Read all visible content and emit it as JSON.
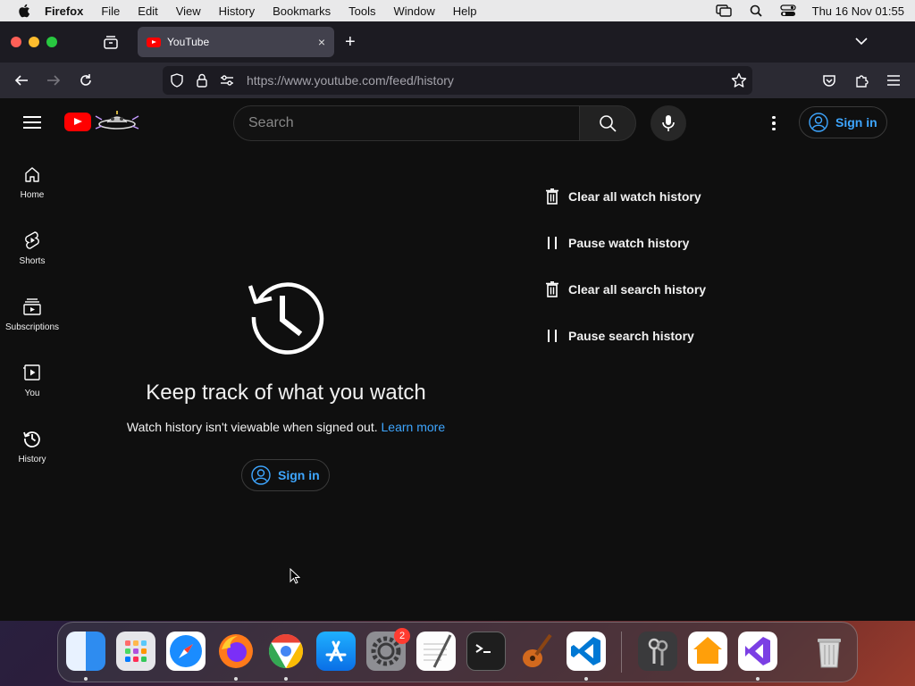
{
  "menubar": {
    "app_name": "Firefox",
    "items": [
      "File",
      "Edit",
      "View",
      "History",
      "Bookmarks",
      "Tools",
      "Window",
      "Help"
    ],
    "clock": "Thu 16 Nov  01:55"
  },
  "browser": {
    "tab_title": "YouTube",
    "tab_close": "×",
    "new_tab": "+",
    "url": "https://www.youtube.com/feed/history"
  },
  "youtube": {
    "search_placeholder": "Search",
    "signin_label": "Sign in",
    "guide": [
      {
        "label": "Home",
        "icon": "home-icon"
      },
      {
        "label": "Shorts",
        "icon": "shorts-icon"
      },
      {
        "label": "Subscriptions",
        "icon": "subscriptions-icon"
      },
      {
        "label": "You",
        "icon": "you-icon"
      },
      {
        "label": "History",
        "icon": "history-icon"
      }
    ],
    "empty_title": "Keep track of what you watch",
    "empty_subtitle": "Watch history isn't viewable when signed out.",
    "learn_more": "Learn more",
    "actions": [
      {
        "label": "Clear all watch history",
        "icon": "trash-icon"
      },
      {
        "label": "Pause watch history",
        "icon": "pause-icon"
      },
      {
        "label": "Clear all search history",
        "icon": "trash-icon"
      },
      {
        "label": "Pause search history",
        "icon": "pause-icon"
      }
    ]
  },
  "dock": {
    "apps": [
      "Finder",
      "Launchpad",
      "Safari",
      "Firefox",
      "Chrome",
      "App Store",
      "System Settings",
      "TextEdit",
      "Terminal",
      "GarageBand",
      "Visual Studio Code",
      "Keychain Access",
      "Home",
      "Visual Studio",
      "Trash"
    ],
    "settings_badge": "2"
  },
  "colors": {
    "youtube_red": "#ff0000",
    "link_blue": "#3ea6ff",
    "page_bg": "#0f0f0f"
  }
}
